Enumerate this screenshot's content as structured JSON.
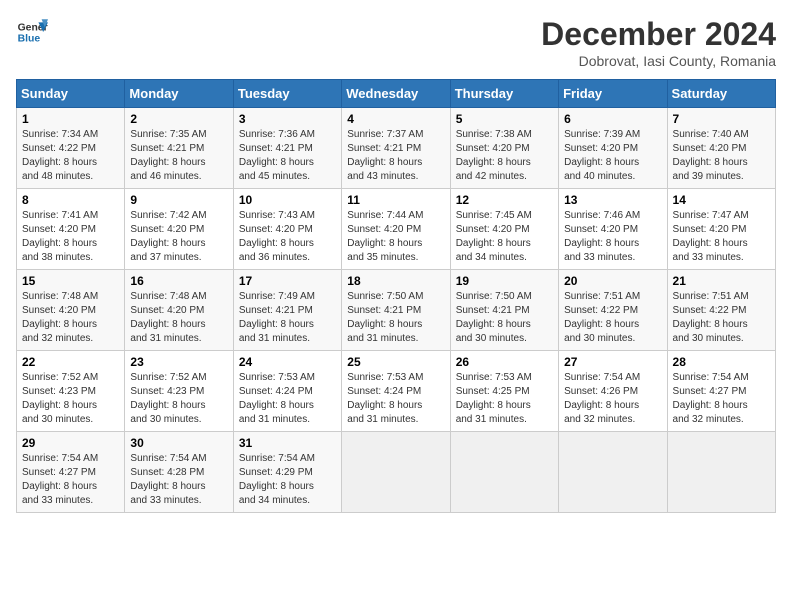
{
  "logo": {
    "line1": "General",
    "line2": "Blue"
  },
  "title": "December 2024",
  "location": "Dobrovat, Iasi County, Romania",
  "days_of_week": [
    "Sunday",
    "Monday",
    "Tuesday",
    "Wednesday",
    "Thursday",
    "Friday",
    "Saturday"
  ],
  "weeks": [
    [
      {
        "day": "1",
        "info": "Sunrise: 7:34 AM\nSunset: 4:22 PM\nDaylight: 8 hours\nand 48 minutes."
      },
      {
        "day": "2",
        "info": "Sunrise: 7:35 AM\nSunset: 4:21 PM\nDaylight: 8 hours\nand 46 minutes."
      },
      {
        "day": "3",
        "info": "Sunrise: 7:36 AM\nSunset: 4:21 PM\nDaylight: 8 hours\nand 45 minutes."
      },
      {
        "day": "4",
        "info": "Sunrise: 7:37 AM\nSunset: 4:21 PM\nDaylight: 8 hours\nand 43 minutes."
      },
      {
        "day": "5",
        "info": "Sunrise: 7:38 AM\nSunset: 4:20 PM\nDaylight: 8 hours\nand 42 minutes."
      },
      {
        "day": "6",
        "info": "Sunrise: 7:39 AM\nSunset: 4:20 PM\nDaylight: 8 hours\nand 40 minutes."
      },
      {
        "day": "7",
        "info": "Sunrise: 7:40 AM\nSunset: 4:20 PM\nDaylight: 8 hours\nand 39 minutes."
      }
    ],
    [
      {
        "day": "8",
        "info": "Sunrise: 7:41 AM\nSunset: 4:20 PM\nDaylight: 8 hours\nand 38 minutes."
      },
      {
        "day": "9",
        "info": "Sunrise: 7:42 AM\nSunset: 4:20 PM\nDaylight: 8 hours\nand 37 minutes."
      },
      {
        "day": "10",
        "info": "Sunrise: 7:43 AM\nSunset: 4:20 PM\nDaylight: 8 hours\nand 36 minutes."
      },
      {
        "day": "11",
        "info": "Sunrise: 7:44 AM\nSunset: 4:20 PM\nDaylight: 8 hours\nand 35 minutes."
      },
      {
        "day": "12",
        "info": "Sunrise: 7:45 AM\nSunset: 4:20 PM\nDaylight: 8 hours\nand 34 minutes."
      },
      {
        "day": "13",
        "info": "Sunrise: 7:46 AM\nSunset: 4:20 PM\nDaylight: 8 hours\nand 33 minutes."
      },
      {
        "day": "14",
        "info": "Sunrise: 7:47 AM\nSunset: 4:20 PM\nDaylight: 8 hours\nand 33 minutes."
      }
    ],
    [
      {
        "day": "15",
        "info": "Sunrise: 7:48 AM\nSunset: 4:20 PM\nDaylight: 8 hours\nand 32 minutes."
      },
      {
        "day": "16",
        "info": "Sunrise: 7:48 AM\nSunset: 4:20 PM\nDaylight: 8 hours\nand 31 minutes."
      },
      {
        "day": "17",
        "info": "Sunrise: 7:49 AM\nSunset: 4:21 PM\nDaylight: 8 hours\nand 31 minutes."
      },
      {
        "day": "18",
        "info": "Sunrise: 7:50 AM\nSunset: 4:21 PM\nDaylight: 8 hours\nand 31 minutes."
      },
      {
        "day": "19",
        "info": "Sunrise: 7:50 AM\nSunset: 4:21 PM\nDaylight: 8 hours\nand 30 minutes."
      },
      {
        "day": "20",
        "info": "Sunrise: 7:51 AM\nSunset: 4:22 PM\nDaylight: 8 hours\nand 30 minutes."
      },
      {
        "day": "21",
        "info": "Sunrise: 7:51 AM\nSunset: 4:22 PM\nDaylight: 8 hours\nand 30 minutes."
      }
    ],
    [
      {
        "day": "22",
        "info": "Sunrise: 7:52 AM\nSunset: 4:23 PM\nDaylight: 8 hours\nand 30 minutes."
      },
      {
        "day": "23",
        "info": "Sunrise: 7:52 AM\nSunset: 4:23 PM\nDaylight: 8 hours\nand 30 minutes."
      },
      {
        "day": "24",
        "info": "Sunrise: 7:53 AM\nSunset: 4:24 PM\nDaylight: 8 hours\nand 31 minutes."
      },
      {
        "day": "25",
        "info": "Sunrise: 7:53 AM\nSunset: 4:24 PM\nDaylight: 8 hours\nand 31 minutes."
      },
      {
        "day": "26",
        "info": "Sunrise: 7:53 AM\nSunset: 4:25 PM\nDaylight: 8 hours\nand 31 minutes."
      },
      {
        "day": "27",
        "info": "Sunrise: 7:54 AM\nSunset: 4:26 PM\nDaylight: 8 hours\nand 32 minutes."
      },
      {
        "day": "28",
        "info": "Sunrise: 7:54 AM\nSunset: 4:27 PM\nDaylight: 8 hours\nand 32 minutes."
      }
    ],
    [
      {
        "day": "29",
        "info": "Sunrise: 7:54 AM\nSunset: 4:27 PM\nDaylight: 8 hours\nand 33 minutes."
      },
      {
        "day": "30",
        "info": "Sunrise: 7:54 AM\nSunset: 4:28 PM\nDaylight: 8 hours\nand 33 minutes."
      },
      {
        "day": "31",
        "info": "Sunrise: 7:54 AM\nSunset: 4:29 PM\nDaylight: 8 hours\nand 34 minutes."
      },
      {
        "day": "",
        "info": ""
      },
      {
        "day": "",
        "info": ""
      },
      {
        "day": "",
        "info": ""
      },
      {
        "day": "",
        "info": ""
      }
    ]
  ]
}
